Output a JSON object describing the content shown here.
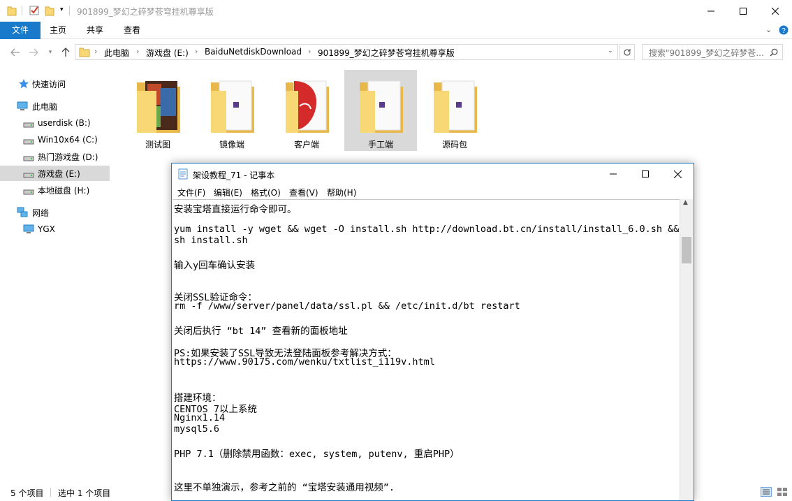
{
  "window": {
    "title": "901899_梦幻之碎梦苍穹挂机尊享版"
  },
  "ribbon": {
    "tabs": [
      "文件",
      "主页",
      "共享",
      "查看"
    ]
  },
  "address": {
    "crumbs": [
      "此电脑",
      "游戏盘 (E:)",
      "BaiduNetdiskDownload",
      "901899_梦幻之碎梦苍穹挂机尊享版"
    ],
    "search_placeholder": "搜索\"901899_梦幻之碎梦苍..."
  },
  "nav": {
    "items": [
      {
        "label": "快速访问",
        "icon": "star-icon"
      },
      {
        "label": "此电脑",
        "icon": "computer-icon"
      },
      {
        "label": "userdisk (B:)",
        "icon": "drive-icon"
      },
      {
        "label": "Win10x64 (C:)",
        "icon": "drive-icon"
      },
      {
        "label": "热门游戏盘 (D:)",
        "icon": "drive-icon"
      },
      {
        "label": "游戏盘 (E:)",
        "icon": "drive-icon",
        "selected": true
      },
      {
        "label": "本地磁盘 (H:)",
        "icon": "drive-icon"
      },
      {
        "label": "网络",
        "icon": "network-icon"
      },
      {
        "label": "YGX",
        "icon": "monitor-icon"
      }
    ]
  },
  "folders": [
    {
      "name": "测试图"
    },
    {
      "name": "镜像端"
    },
    {
      "name": "客户端"
    },
    {
      "name": "手工端",
      "selected": true
    },
    {
      "name": "源码包"
    }
  ],
  "status": {
    "count": "5 个项目",
    "selected": "选中 1 个项目"
  },
  "notepad": {
    "title": "架设教程_71 - 记事本",
    "menu": [
      "文件(F)",
      "编辑(E)",
      "格式(O)",
      "查看(V)",
      "帮助(H)"
    ],
    "lines": [
      "安装宝塔直接运行命令即可。",
      "",
      "yum install -y wget && wget -O install.sh http://download.bt.cn/install/install_6.0.sh &&",
      "sh install.sh",
      "",
      "输入y回车确认安装",
      "",
      "",
      "关闭SSL验证命令：",
      "rm -f /www/server/panel/data/ssl.pl && /etc/init.d/bt restart",
      "",
      "关闭后执行 “bt 14” 查看新的面板地址",
      "",
      "PS:如果安装了SSL导致无法登陆面板参考解决方式：",
      "https://www.90175.com/wenku/txtlist_i119v.html",
      "",
      "",
      "搭建环境：",
      "CENTOS 7以上系统",
      "Nginx1.14",
      "mysql5.6",
      "",
      "PHP 7.1（删除禁用函数：exec, system, putenv, 重启PHP）",
      "",
      "",
      "这里不单独演示，参考之前的 “宝塔安装通用视频”."
    ]
  },
  "colors": {
    "accent": "#1979ca",
    "selection": "#d9d9d9",
    "folder": "#f8d775"
  }
}
